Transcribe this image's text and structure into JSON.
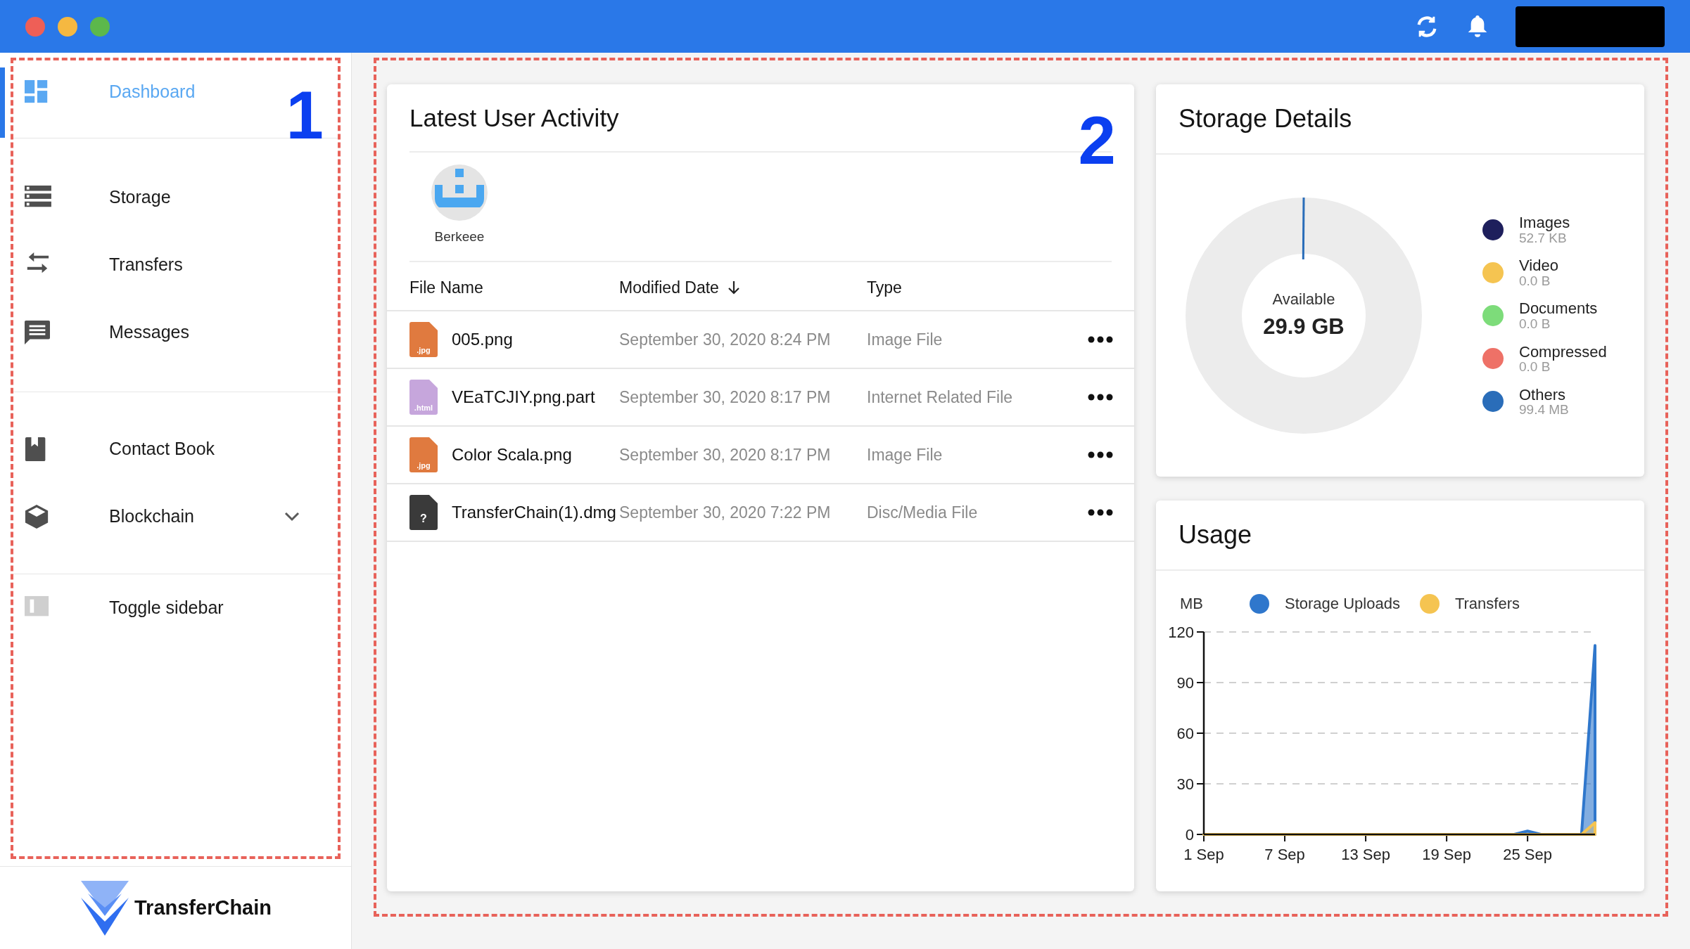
{
  "sidebar": {
    "annotation": "1",
    "sections": [
      {
        "items": [
          {
            "kind": "dashboard",
            "label": "Dashboard",
            "selected": true
          }
        ]
      },
      {
        "items": [
          {
            "kind": "storage",
            "label": "Storage",
            "selected": false
          },
          {
            "kind": "transfers",
            "label": "Transfers",
            "selected": false
          },
          {
            "kind": "messages",
            "label": "Messages",
            "selected": false
          }
        ]
      },
      {
        "items": [
          {
            "kind": "contacts",
            "label": "Contact Book",
            "selected": false
          },
          {
            "kind": "blockchain",
            "label": "Blockchain",
            "selected": false,
            "expanded": false
          }
        ]
      },
      {
        "items": [
          {
            "kind": "toggle",
            "label": "Toggle sidebar",
            "selected": false
          }
        ]
      }
    ],
    "logo_text": "TransferChain"
  },
  "main": {
    "annotation": "2",
    "activity": {
      "title": "Latest User Activity",
      "users": [
        {
          "name": "Berkeee"
        }
      ],
      "columns": [
        {
          "label": "File Name"
        },
        {
          "label": "Modified Date",
          "sorted": true
        },
        {
          "label": "Type"
        }
      ],
      "rows": [
        {
          "kind": "jpg",
          "icon_label": ".jpg",
          "name": "005.png",
          "modified": "September 30, 2020 8:24 PM",
          "type": "Image File"
        },
        {
          "kind": "html",
          "icon_label": ".html",
          "name": "VEaTCJIY.png.part",
          "modified": "September 30, 2020 8:17 PM",
          "type": "Internet Related File"
        },
        {
          "kind": "jpg",
          "icon_label": ".jpg",
          "name": "Color Scala.png",
          "modified": "September 30, 2020 8:17 PM",
          "type": "Image File"
        },
        {
          "kind": "unknown",
          "icon_label": "?",
          "name": "TransferChain(1).dmg",
          "modified": "September 30, 2020 7:22 PM",
          "type": "Disc/Media File"
        }
      ]
    },
    "storage": {
      "title": "Storage Details",
      "available_label": "Available",
      "available_value": "29.9 GB",
      "categories": [
        {
          "name": "Images",
          "size": "52.7 KB",
          "color": "#1e1f5c"
        },
        {
          "name": "Video",
          "size": "0.0 B",
          "color": "#f5c451"
        },
        {
          "name": "Documents",
          "size": "0.0 B",
          "color": "#7ddc7a"
        },
        {
          "name": "Compressed",
          "size": "0.0 B",
          "color": "#ee7167"
        },
        {
          "name": "Others",
          "size": "99.4 MB",
          "color": "#2a6db9"
        }
      ]
    },
    "usage": {
      "title": "Usage",
      "chart_data": {
        "type": "area",
        "ylabel": "MB",
        "categories": [
          "1 Sep",
          null,
          null,
          null,
          null,
          null,
          "7 Sep",
          null,
          null,
          null,
          null,
          null,
          "13 Sep",
          null,
          null,
          null,
          null,
          null,
          "19 Sep",
          null,
          null,
          null,
          null,
          null,
          "25 Sep",
          null,
          null,
          null,
          null,
          null
        ],
        "series": [
          {
            "name": "Storage Uploads",
            "color": "#2f77cc",
            "values": [
              0,
              0,
              0,
              0,
              0,
              0,
              0,
              0,
              0,
              0,
              0,
              0,
              0,
              0,
              0,
              0,
              0,
              0,
              0,
              0,
              0,
              0,
              0,
              0,
              2,
              0,
              0,
              0,
              0,
              112
            ]
          },
          {
            "name": "Transfers",
            "color": "#f5c451",
            "values": [
              0,
              0,
              0,
              0,
              0,
              0,
              0,
              0,
              0,
              0,
              0,
              0,
              0,
              0,
              0,
              0,
              0,
              0,
              0,
              0,
              0,
              0,
              0,
              0,
              0,
              0,
              0,
              0,
              0,
              7
            ]
          }
        ],
        "ylim": [
          0,
          120
        ],
        "yticks": [
          0,
          30,
          60,
          90,
          120
        ],
        "grid": true
      }
    }
  }
}
